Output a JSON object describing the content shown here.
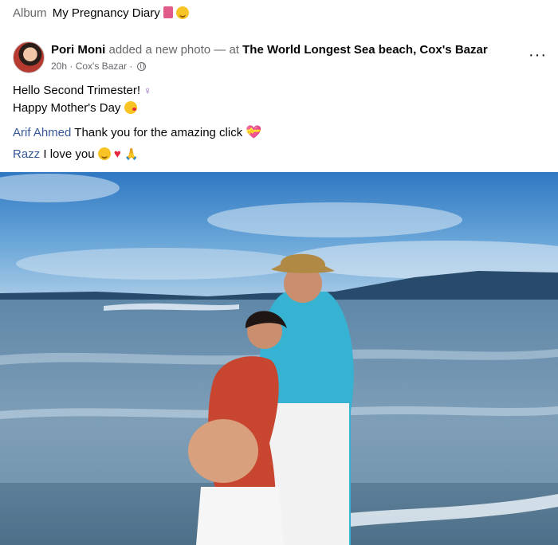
{
  "album": {
    "prefix": "Album",
    "name": "My Pregnancy Diary"
  },
  "post": {
    "author": "Pori Moni",
    "action": "added a new photo — at",
    "place": "The World Longest Sea beach, Cox's Bazar",
    "time": "20h",
    "location": "Cox's Bazar"
  },
  "caption": {
    "line1": "Hello Second Trimester!",
    "line2": "Happy Mother's Day",
    "mention1": "Arif Ahmed",
    "line3": "Thank you for the amazing click",
    "mention2": "Razz",
    "line4": "I love you"
  },
  "colors": {
    "mention": "#385898",
    "sky": "#3f86c6",
    "sea": "#5a7f9c",
    "shirt": "#35b8d8",
    "dress": "#c8452f"
  },
  "icons": [
    "book-emoji",
    "hug-emoji",
    "globe-icon",
    "more-icon",
    "female-sign-emoji",
    "kiss-emoji",
    "heart-box-emoji",
    "heart-emoji",
    "folded-hands-emoji"
  ]
}
